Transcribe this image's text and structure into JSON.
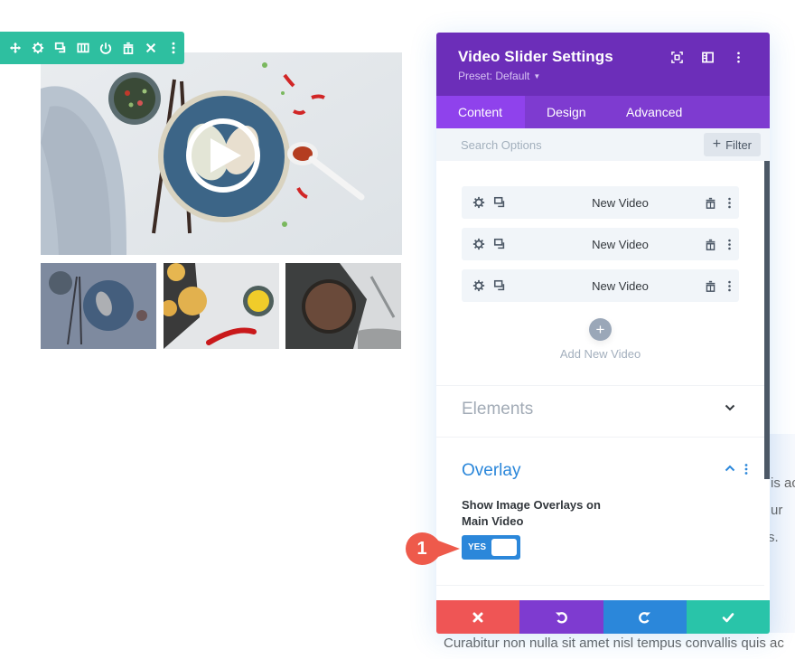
{
  "module_toolbar": {
    "color": "#2ebfa0",
    "icons": [
      "move-icon",
      "gear-icon",
      "duplicate-icon",
      "columns-icon",
      "power-icon",
      "trash-icon",
      "close-icon",
      "more-icon"
    ]
  },
  "slider": {
    "main_image": "Food photo: spring rolls on blue plate with chopsticks, dipping bowl and chili peppers",
    "play_icon": "play-icon",
    "thumbnails": [
      {
        "alt": "Spring rolls on blue plate (active, overlay)"
      },
      {
        "alt": "Corn fritters with corn bowl and red chili"
      },
      {
        "alt": "Chocolate tart on dark board with knife"
      }
    ]
  },
  "panel": {
    "title": "Video Slider Settings",
    "preset": "Preset: Default",
    "header_icons": [
      "focus-icon",
      "sidebar-icon",
      "more-icon"
    ],
    "tabs": [
      {
        "label": "Content",
        "active": true
      },
      {
        "label": "Design",
        "active": false
      },
      {
        "label": "Advanced",
        "active": false
      }
    ],
    "search": {
      "placeholder": "Search Options",
      "value": ""
    },
    "filter_label": "Filter",
    "videos": [
      {
        "label": "New Video"
      },
      {
        "label": "New Video"
      },
      {
        "label": "New Video"
      }
    ],
    "add_video_label": "Add New Video",
    "sections": {
      "elements": {
        "title": "Elements",
        "expanded": false
      },
      "overlay": {
        "title": "Overlay",
        "expanded": true,
        "option_label": "Show Image Overlays on Main Video",
        "toggle": {
          "label": "YES",
          "value": true
        }
      }
    },
    "footer": {
      "cancel": "cancel-icon",
      "undo": "undo-icon",
      "redo": "redo-icon",
      "save": "save-icon"
    },
    "colors": {
      "header": "#6c2eb9",
      "tabs": "#7e3bd0",
      "active_tab": "#8f42ec",
      "accent": "#2b87da",
      "cancel": "#ef5555",
      "save": "#29c4a9"
    }
  },
  "annotation": {
    "number": "1",
    "color": "#ee5a4b"
  },
  "background_text": {
    "line1": "is ac",
    "line2": "ur",
    "line3": "s.",
    "bottom": "Curabitur non nulla sit amet nisl tempus convallis quis ac"
  }
}
